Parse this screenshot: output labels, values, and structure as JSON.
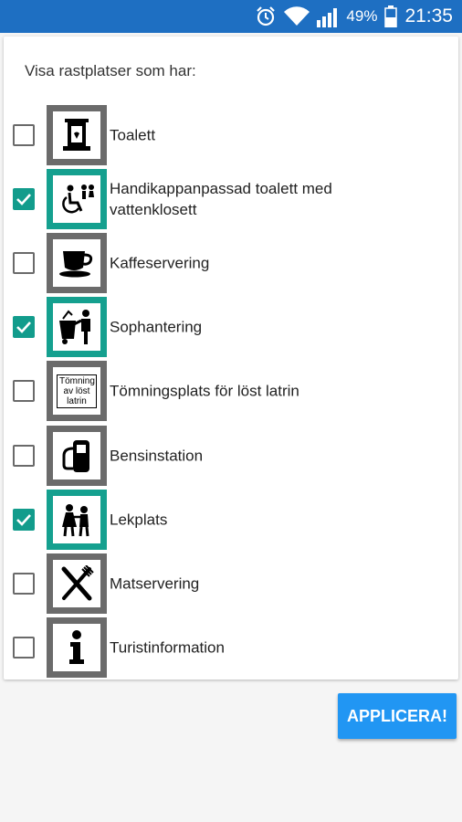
{
  "status_bar": {
    "battery_percent": "49%",
    "time": "21:35",
    "icons": [
      "alarm-icon",
      "wifi-icon",
      "signal-icon",
      "battery-icon"
    ]
  },
  "filter": {
    "heading": "Visa rastplatser som har:",
    "items": [
      {
        "label": "Toalett",
        "checked": false,
        "icon": "toilet-icon"
      },
      {
        "label": "Handikappanpassad toalett med vattenklosett",
        "checked": true,
        "icon": "wheelchair-toilet-icon"
      },
      {
        "label": "Kaffeservering",
        "checked": false,
        "icon": "coffee-cup-icon"
      },
      {
        "label": "Sophantering",
        "checked": true,
        "icon": "waste-disposal-icon"
      },
      {
        "label": "Tömningsplats för löst latrin",
        "checked": false,
        "icon": "latrine-emptying-icon",
        "icon_text": "Tömning av löst latrin"
      },
      {
        "label": "Bensinstation",
        "checked": false,
        "icon": "fuel-pump-icon"
      },
      {
        "label": "Lekplats",
        "checked": true,
        "icon": "playground-icon"
      },
      {
        "label": "Matservering",
        "checked": false,
        "icon": "fork-knife-icon"
      },
      {
        "label": "Turistinformation",
        "checked": false,
        "icon": "info-icon"
      }
    ]
  },
  "apply_button": {
    "label": "APPLICERA!"
  },
  "colors": {
    "status_bar": "#1e6fc2",
    "checked": "#129c8c",
    "icon_border_active": "#15a08f",
    "icon_border_inactive": "#6b6b6b",
    "button": "#2196f3"
  }
}
